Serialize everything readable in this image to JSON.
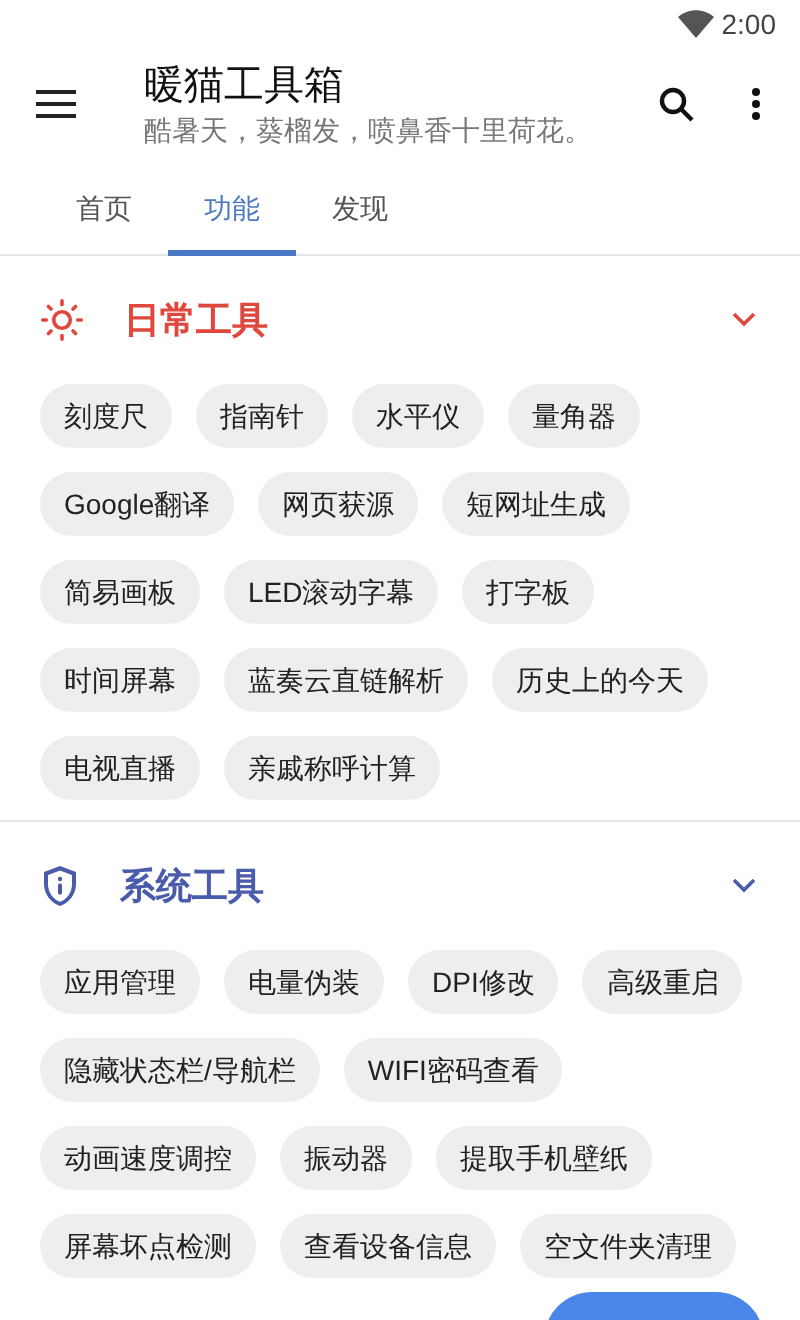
{
  "status_bar": {
    "time": "2:00"
  },
  "app_bar": {
    "title": "暖猫工具箱",
    "subtitle": "酷暑天，葵榴发，喷鼻香十里荷花。"
  },
  "tabs": [
    {
      "label": "首页",
      "selected": false
    },
    {
      "label": "功能",
      "selected": true
    },
    {
      "label": "发现",
      "selected": false
    }
  ],
  "sections": [
    {
      "title": "日常工具",
      "kind": "sun",
      "color": "#e0483e",
      "expanded": true,
      "tools": [
        "刻度尺",
        "指南针",
        "水平仪",
        "量角器",
        "Google翻译",
        "网页获源",
        "短网址生成",
        "简易画板",
        "LED滚动字幕",
        "打字板",
        "时间屏幕",
        "蓝奏云直链解析",
        "历史上的今天",
        "电视直播",
        "亲戚称呼计算"
      ]
    },
    {
      "title": "系统工具",
      "kind": "shield",
      "color": "#4b5bab",
      "expanded": true,
      "tools": [
        "应用管理",
        "电量伪装",
        "DPI修改",
        "高级重启",
        "隐藏状态栏/导航栏",
        "WIFI密码查看",
        "动画速度调控",
        "振动器",
        "提取手机壁纸",
        "屏幕坏点检测",
        "查看设备信息",
        "空文件夹清理"
      ]
    }
  ]
}
